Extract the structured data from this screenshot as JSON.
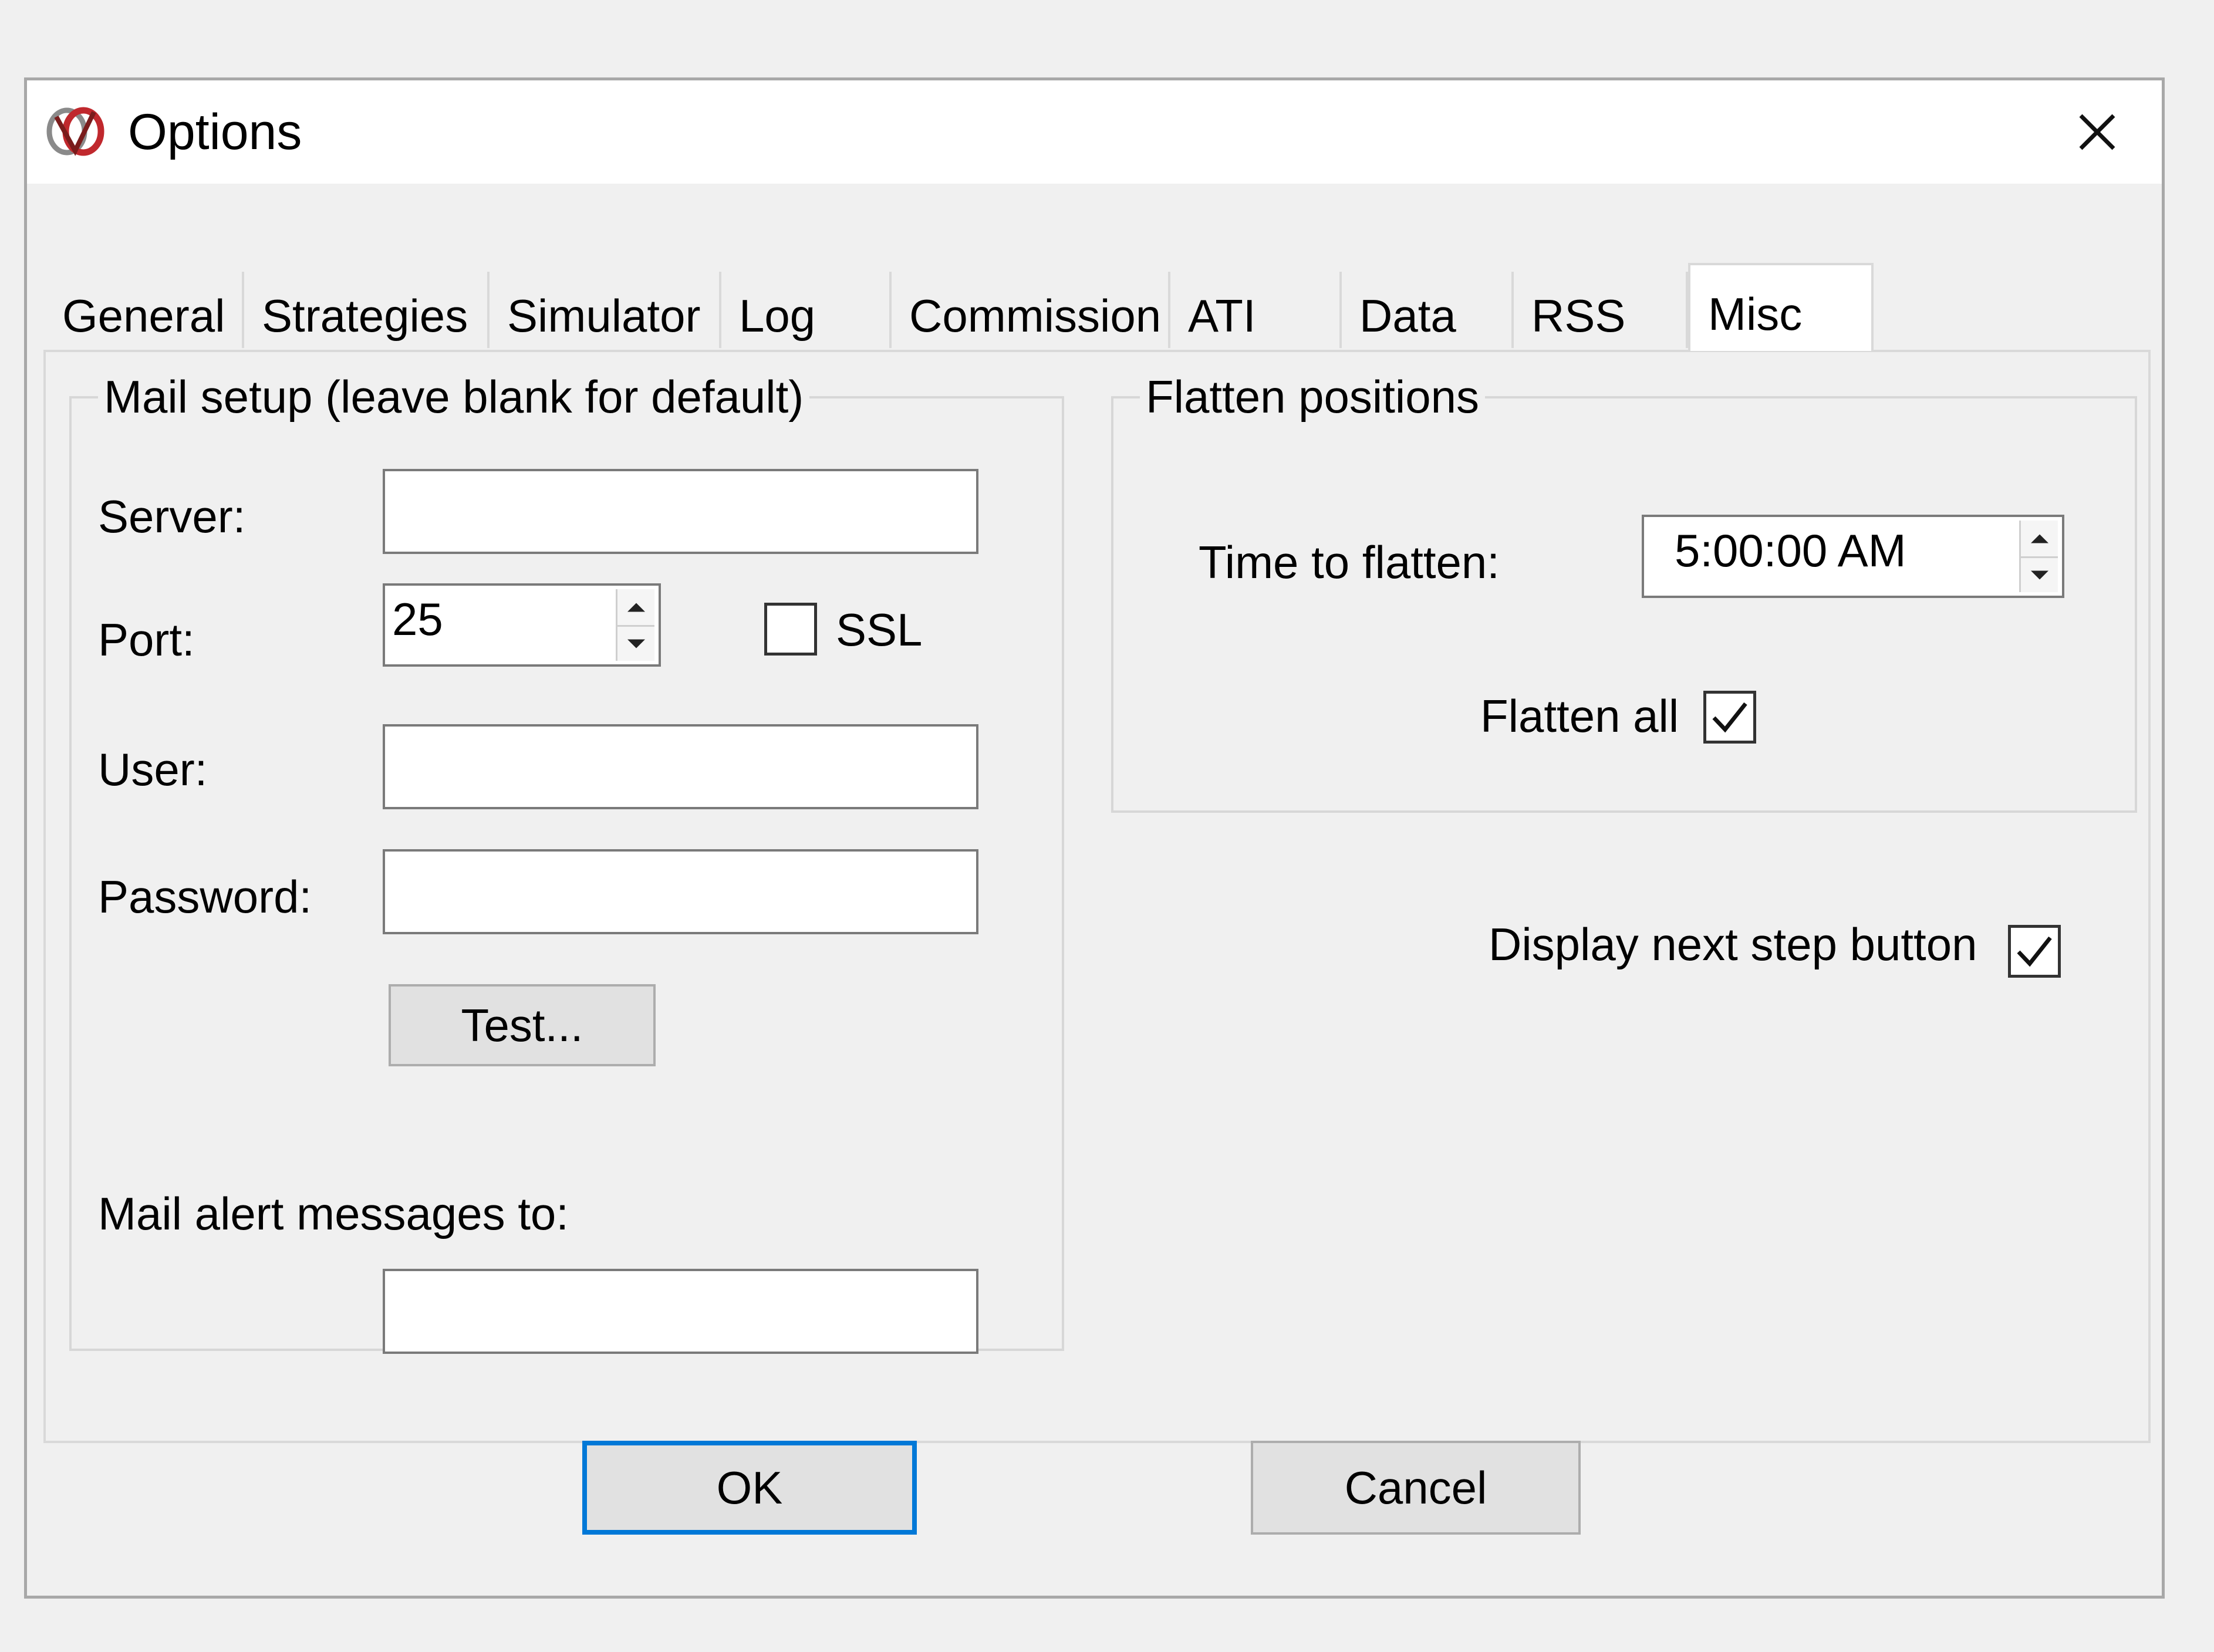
{
  "window": {
    "title": "Options",
    "icon": "app-logo-icon",
    "close_icon": "close-icon"
  },
  "tabs": [
    {
      "label": "General",
      "active": false
    },
    {
      "label": "Strategies",
      "active": false
    },
    {
      "label": "Simulator",
      "active": false
    },
    {
      "label": "Log",
      "active": false
    },
    {
      "label": "Commission",
      "active": false
    },
    {
      "label": "ATI",
      "active": false
    },
    {
      "label": "Data",
      "active": false
    },
    {
      "label": "RSS",
      "active": false
    },
    {
      "label": "Misc",
      "active": true
    }
  ],
  "mail_setup": {
    "group_label": "Mail setup (leave blank for default)",
    "server_label": "Server:",
    "server_value": "",
    "port_label": "Port:",
    "port_value": "25",
    "ssl_label": "SSL",
    "ssl_checked": false,
    "user_label": "User:",
    "user_value": "",
    "password_label": "Password:",
    "password_value": "",
    "test_button": "Test...",
    "alert_label": "Mail alert messages to:",
    "alert_value": ""
  },
  "flatten": {
    "group_label": "Flatten positions",
    "time_label": "Time to flatten:",
    "time_value": "5:00:00 AM",
    "flatten_all_label": "Flatten all",
    "flatten_all_checked": true
  },
  "next_step": {
    "label": "Display next step button",
    "checked": true
  },
  "buttons": {
    "ok": "OK",
    "cancel": "Cancel"
  },
  "colors": {
    "window_bg": "#f0f0f0",
    "default_button_border": "#0078d7",
    "logo_red": "#c0282d"
  }
}
